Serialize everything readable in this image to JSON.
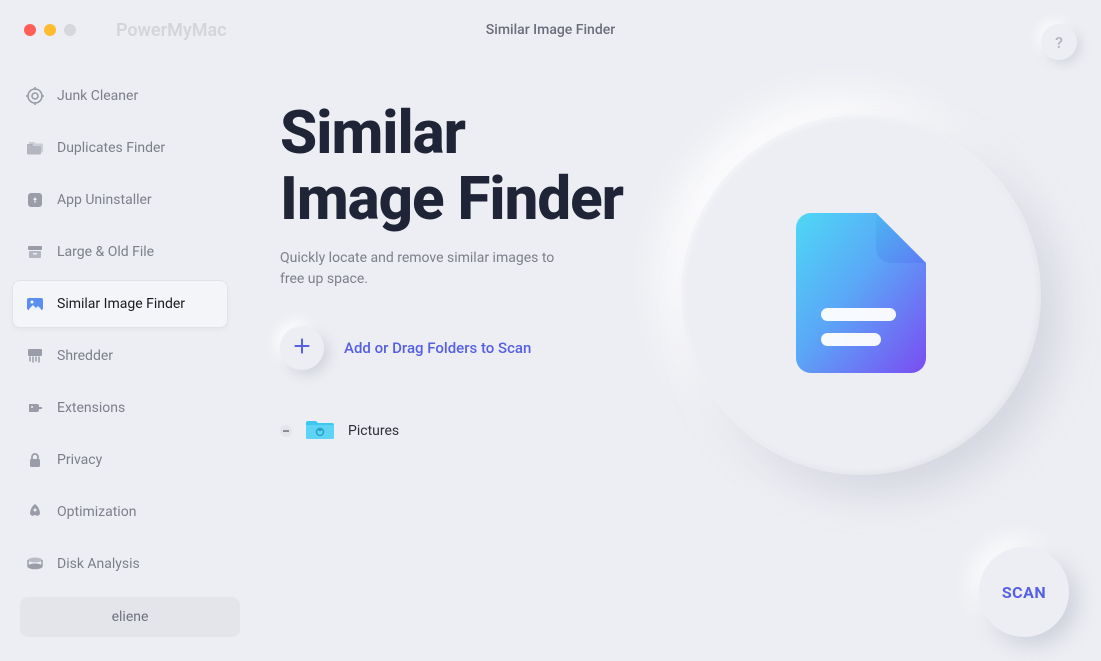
{
  "app_name": "PowerMyMac",
  "window_title": "Similar Image Finder",
  "help_label": "?",
  "sidebar": {
    "items": [
      {
        "label": "Junk Cleaner"
      },
      {
        "label": "Duplicates Finder"
      },
      {
        "label": "App Uninstaller"
      },
      {
        "label": "Large & Old File"
      },
      {
        "label": "Similar Image Finder"
      },
      {
        "label": "Shredder"
      },
      {
        "label": "Extensions"
      },
      {
        "label": "Privacy"
      },
      {
        "label": "Optimization"
      },
      {
        "label": "Disk Analysis"
      }
    ]
  },
  "user": "eliene",
  "main": {
    "title_line1": "Similar",
    "title_line2": "Image Finder",
    "description": "Quickly locate and remove similar images to free up space.",
    "add_label": "Add or Drag Folders to Scan",
    "folders": [
      {
        "name": "Pictures"
      }
    ]
  },
  "scan_label": "SCAN"
}
